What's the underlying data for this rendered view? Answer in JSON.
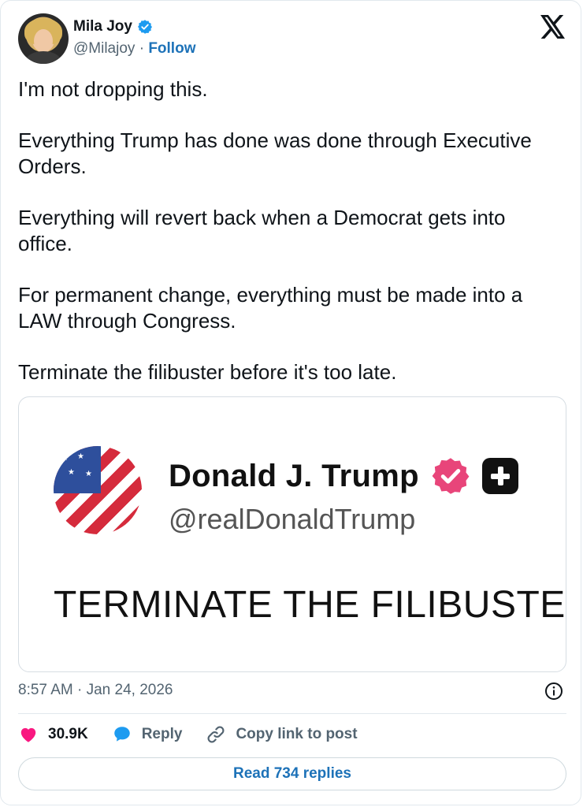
{
  "author": {
    "name": "Mila Joy",
    "handle": "@Milajoy",
    "separator": "·",
    "follow_label": "Follow"
  },
  "tweet": {
    "paragraphs": [
      "I'm not dropping this.",
      "Everything Trump has done was done through Executive Orders.",
      "Everything will revert back when a Democrat gets into office.",
      "For permanent change, everything must be made into a LAW through Congress.",
      "Terminate the filibuster before it's too late."
    ]
  },
  "embedded": {
    "name": "Donald J. Trump",
    "handle": "@realDonaldTrump",
    "text": "TERMINATE THE FILIBUSTER"
  },
  "meta": {
    "timestamp": "8:57 AM · Jan 24, 2026"
  },
  "actions": {
    "like_count": "30.9K",
    "reply_label": "Reply",
    "copy_label": "Copy link to post"
  },
  "read_replies_label": "Read 734 replies",
  "colors": {
    "accent": "#1d72b8",
    "verified": "#1d9bf0",
    "like": "#f91880",
    "trump_badge": "#e8457a"
  },
  "icons": [
    "verified-icon",
    "x-logo-icon",
    "info-icon",
    "heart-icon",
    "reply-bubble-icon",
    "link-icon"
  ]
}
